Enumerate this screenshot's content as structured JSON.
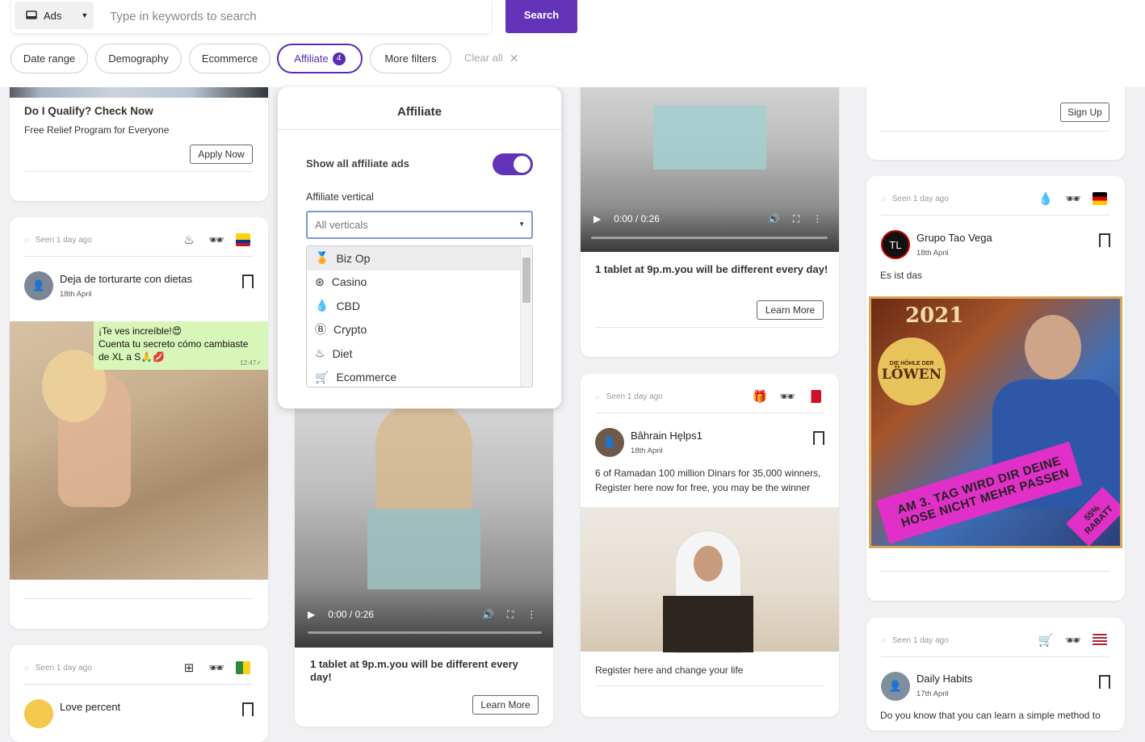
{
  "search": {
    "type_label": "Ads",
    "placeholder": "Type in keywords to search",
    "button": "Search"
  },
  "filters": {
    "date_range": "Date range",
    "demography": "Demography",
    "ecommerce": "Ecommerce",
    "affiliate": "Affiliate",
    "affiliate_count": "4",
    "more_filters": "More filters",
    "clear_all": "Clear all"
  },
  "popup": {
    "title": "Affiliate",
    "toggle_label": "Show all affiliate ads",
    "toggle_on": true,
    "vertical_label": "Affiliate vertical",
    "select_placeholder": "All verticals",
    "options": [
      "Biz Op",
      "Casino",
      "CBD",
      "Crypto",
      "Diet",
      "Ecommerce"
    ]
  },
  "cards": {
    "c1": {
      "title": "Do I Qualify? Check Now",
      "text": "Free Relief Program for Everyone",
      "button": "Apply Now"
    },
    "c2": {
      "seen": "Seen 1 day ago",
      "name": "Deja de torturarte con dietas",
      "date": "18th April",
      "chat_line1": "¡Te ves increíble!😍",
      "chat_line2": "Cuenta tu secreto cómo cambiaste",
      "chat_line3": "de XL a S🙏💋",
      "chat_time": "12:47✓"
    },
    "c3": {
      "seen": "Seen 1 day ago",
      "name": "Love percent"
    },
    "c4": {
      "time": "0:00 / 0:26",
      "text": "1 tablet at 9p.m.you will be different every day!",
      "button": "Learn More"
    },
    "c5": {
      "time": "0:00 / 0:26",
      "text": "1 tablet at 9p.m.you will be different every day!",
      "button": "Learn More"
    },
    "c6": {
      "seen": "Seen 1 day ago",
      "name": "Bâhrain Hęlps1",
      "date": "18th April",
      "text": "6 of Ramadan 100 million Dinars for 35,000 winners, Register here now for free, you may be the winner",
      "footer": "Register here and change your life"
    },
    "c7": {
      "button": "Sign Up"
    },
    "c8": {
      "seen": "Seen 1 day ago",
      "name": "Grupo Tao Vega",
      "date": "18th April",
      "text": "Es ist das",
      "img_year": "2021",
      "img_logo1": "DIE HÖHLE DER",
      "img_logo2": "LÖWEN",
      "img_line1": "AM 3. TAG WIRD DIR DEINE",
      "img_line2": "HOSE NICHT MEHR PASSEN",
      "img_discount": "55% RABATT"
    },
    "c9": {
      "seen": "Seen 1 day ago",
      "name": "Daily Habits",
      "date": "17th April",
      "text": "Do you know that you can learn a simple method to"
    }
  },
  "colors": {
    "accent": "#6233b8"
  }
}
